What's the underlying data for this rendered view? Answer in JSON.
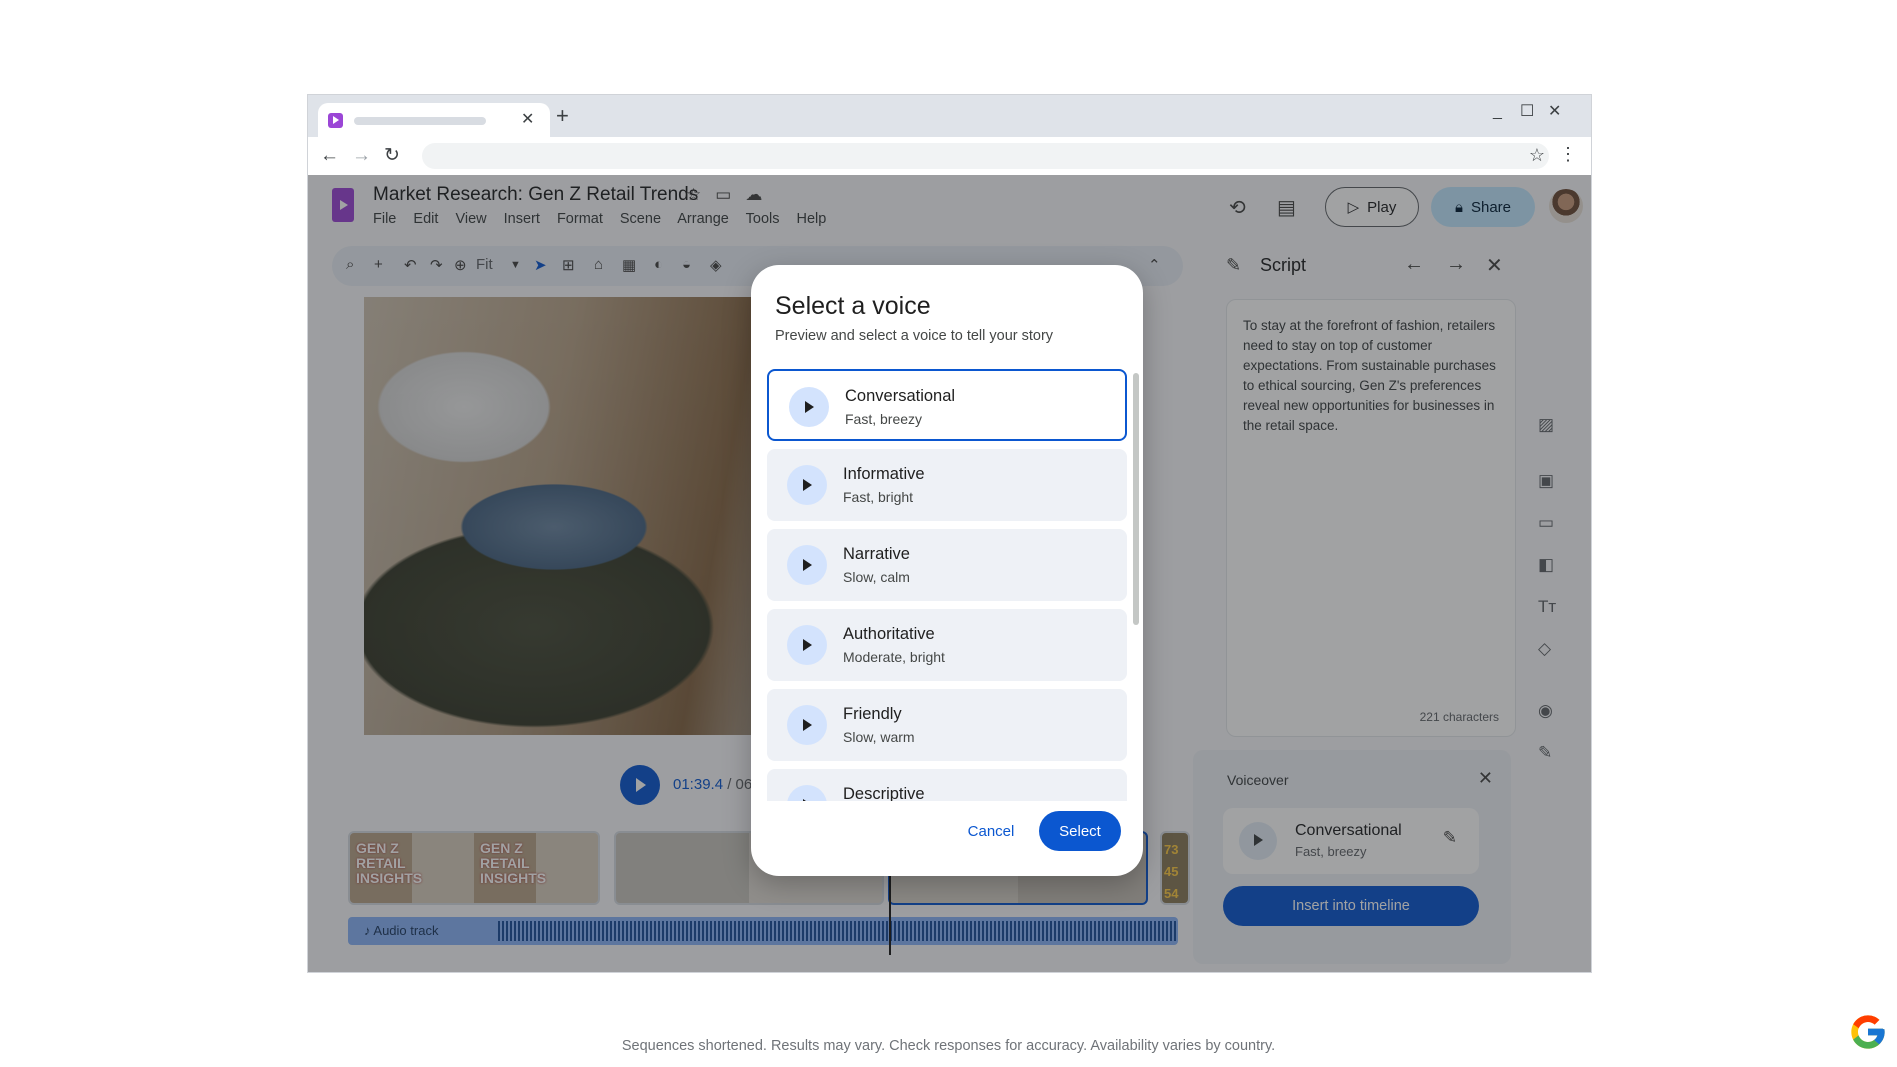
{
  "browser": {
    "tab_close": "✕",
    "new_tab": "+",
    "window_controls": {
      "minimize": "_",
      "maximize": "☐",
      "close": "✕"
    },
    "nav": {
      "back": "←",
      "forward": "→",
      "reload": "↻"
    },
    "bookmark_icon": "☆",
    "menu_icon": "⋮"
  },
  "app": {
    "title": "Market Research: Gen Z Retail Trends",
    "menu": [
      "File",
      "Edit",
      "View",
      "Insert",
      "Format",
      "Scene",
      "Arrange",
      "Tools",
      "Help"
    ],
    "header": {
      "play_label": "Play",
      "share_label": "Share"
    },
    "toolbar": {
      "zoom_label": "Fit"
    },
    "playback": {
      "current_time": "01:39.4",
      "duration_partial": " / 06:"
    },
    "timeline": {
      "clip1_label_a": "GEN Z\nRETAIL\nINSIGHTS",
      "clip1_label_b": "GEN Z\nRETAIL\nINSIGHTS",
      "clip4_numbers": "73\n45\n54",
      "audio_label": "Audio track"
    },
    "script_panel": {
      "title": "Script",
      "text": "To stay at the forefront of fashion, retailers need to stay on top of customer expectations. From sustainable purchases to ethical sourcing, Gen Z's preferences reveal new opportunities for businesses in the retail space.",
      "char_count": "221 characters"
    },
    "voiceover": {
      "title": "Voiceover",
      "voice_name": "Conversational",
      "voice_desc": "Fast, breezy",
      "insert_label": "Insert into timeline"
    }
  },
  "dialog": {
    "title": "Select a voice",
    "subtitle": "Preview and select a voice to tell your story",
    "voices": [
      {
        "name": "Conversational",
        "desc": "Fast, breezy"
      },
      {
        "name": "Informative",
        "desc": "Fast, bright"
      },
      {
        "name": "Narrative",
        "desc": "Slow, calm"
      },
      {
        "name": "Authoritative",
        "desc": "Moderate, bright"
      },
      {
        "name": "Friendly",
        "desc": "Slow, warm"
      },
      {
        "name": "Descriptive",
        "desc": ""
      }
    ],
    "selected_voice": "Conversational",
    "cancel_label": "Cancel",
    "select_label": "Select"
  },
  "footer": {
    "disclaimer": "Sequences shortened. Results may vary. Check responses for accuracy. Availability varies by country."
  },
  "colors": {
    "accent": "#0b57d0",
    "app_brand": "#9b46d6",
    "share_bg": "#c2e7ff"
  }
}
